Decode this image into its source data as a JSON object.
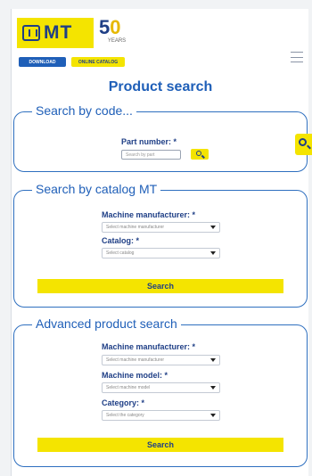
{
  "header": {
    "logo_text": "MT",
    "anniversary": {
      "number_prefix": "5",
      "number_suffix": "0",
      "subtitle": "YEARS"
    },
    "download_label": "DOWNLOAD",
    "catalog_label": "ONLINE CATALOG"
  },
  "page_title": "Product search",
  "search_by_code": {
    "legend": "Search by code...",
    "part_number_label": "Part number: *",
    "part_number_placeholder": "Search by part"
  },
  "search_by_catalog": {
    "legend": "Search by catalog MT",
    "manufacturer_label": "Machine manufacturer: *",
    "manufacturer_value": "Select machine manufacturer",
    "catalog_label": "Catalog: *",
    "catalog_value": "Select catalog",
    "search_label": "Search"
  },
  "advanced_search": {
    "legend": "Advanced product search",
    "manufacturer_label": "Machine manufacturer: *",
    "manufacturer_value": "Select machine manufacturer",
    "model_label": "Machine model: *",
    "model_value": "Select machine model",
    "category_label": "Category: *",
    "category_value": "Select the category",
    "search_label": "Search"
  },
  "colors": {
    "brand_blue": "#1f5fb8",
    "brand_yellow": "#f4e400",
    "navy": "#1f3f86"
  },
  "icons": [
    "mt-logo-icon",
    "search-icon",
    "hamburger-icon",
    "chevron-down-icon"
  ]
}
